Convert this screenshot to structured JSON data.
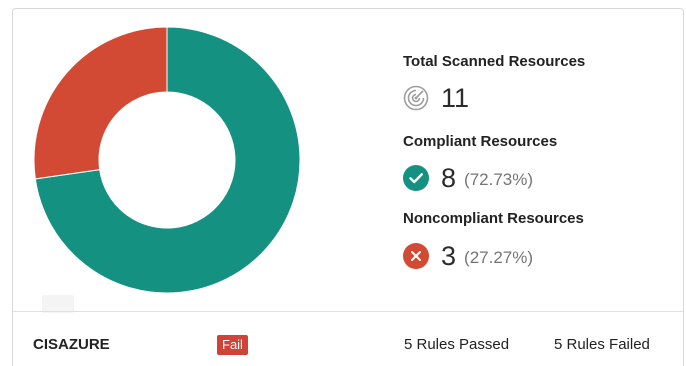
{
  "colors": {
    "compliant": "#149181",
    "noncompliant": "#d24a33",
    "fail_badge": "#d04437",
    "scanned_icon": "#9e9e9e"
  },
  "chart_data": {
    "type": "pie",
    "donut": true,
    "categories": [
      "Compliant Resources",
      "Noncompliant Resources"
    ],
    "values": [
      8,
      3
    ]
  },
  "stats": {
    "total": {
      "label": "Total Scanned Resources",
      "value": "11",
      "icon": "radar-icon"
    },
    "compliant": {
      "label": "Compliant Resources",
      "value": "8",
      "percent": "(72.73%)",
      "icon": "check-circle-icon"
    },
    "noncompliant": {
      "label": "Noncompliant Resources",
      "value": "3",
      "percent": "(27.27%)",
      "icon": "close-circle-icon"
    }
  },
  "footer": {
    "framework": "CISAZURE",
    "status": "Fail",
    "rules_passed": "5 Rules Passed",
    "rules_failed": "5 Rules Failed"
  }
}
